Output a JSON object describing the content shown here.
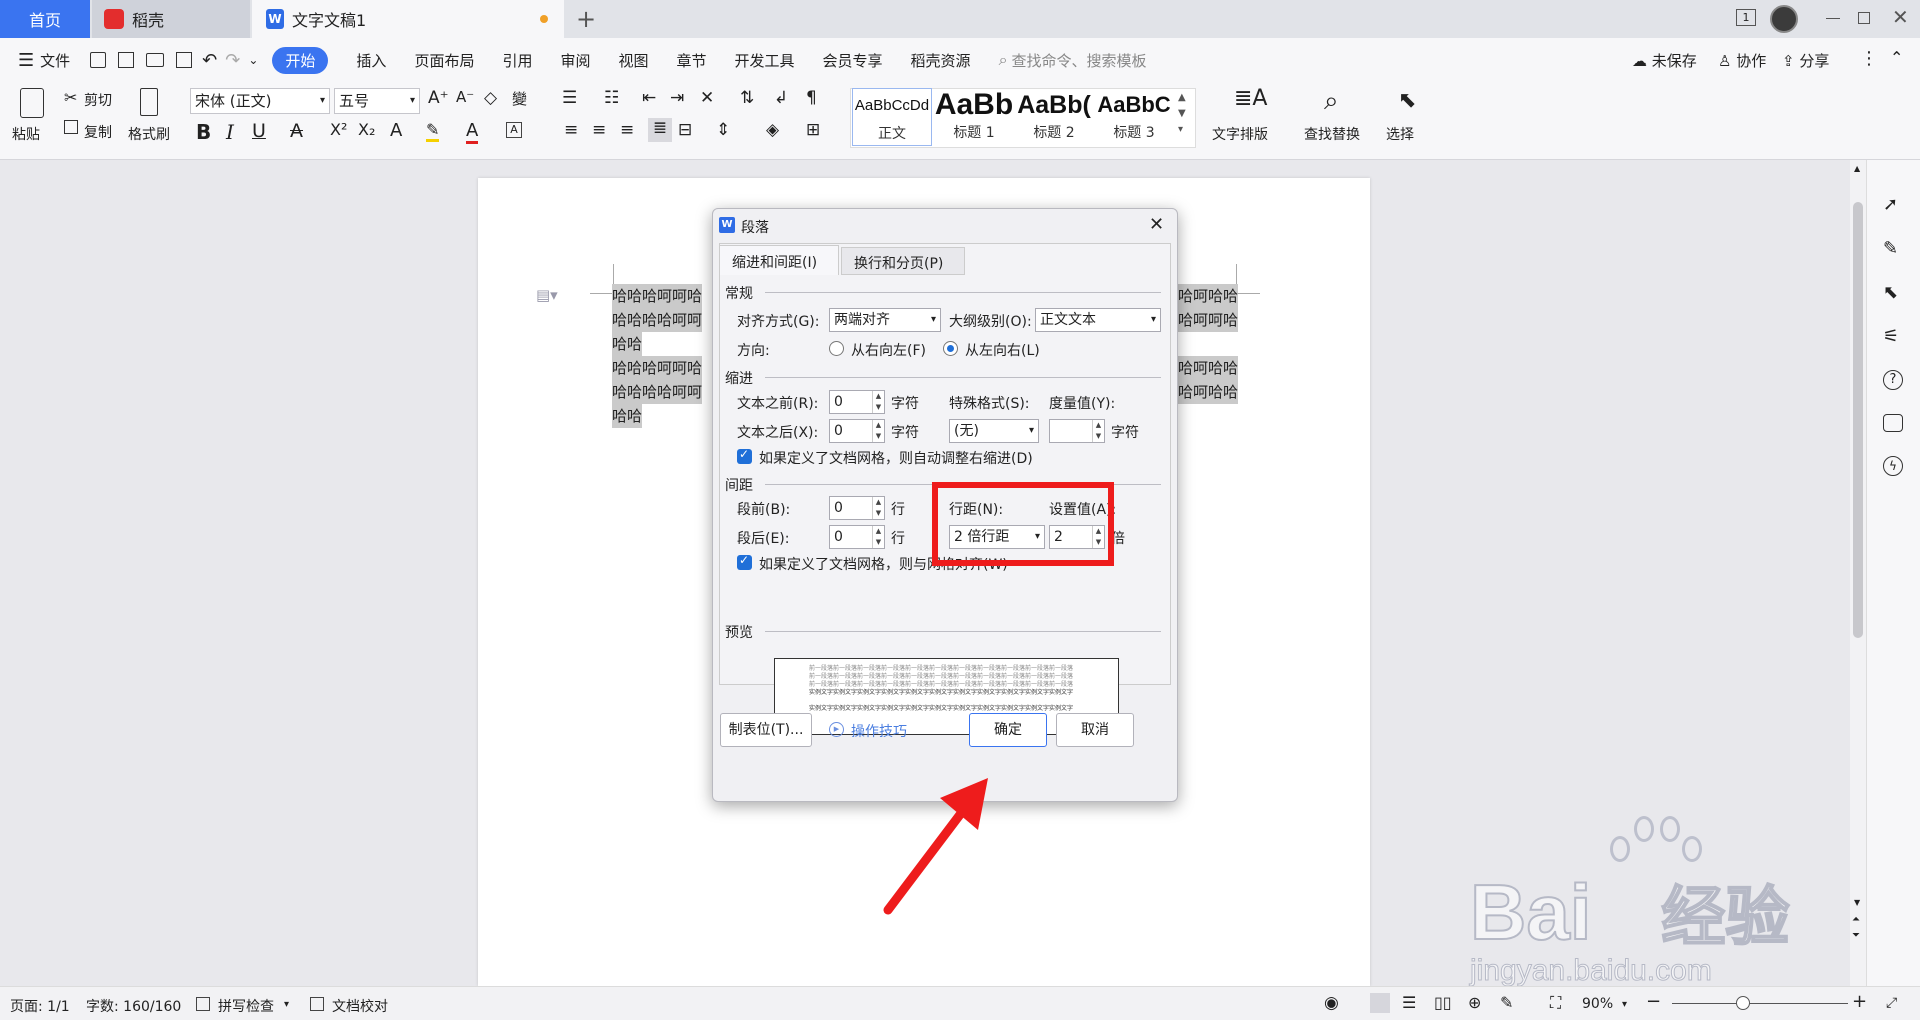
{
  "tabs": {
    "home": "首页",
    "daoke": "稻壳",
    "doc": "文字文稿1",
    "add": "+"
  },
  "window": {
    "badge": "1"
  },
  "menubar": {
    "file": "文件",
    "start": "开始",
    "items": [
      "插入",
      "页面布局",
      "引用",
      "审阅",
      "视图",
      "章节",
      "开发工具",
      "会员专享",
      "稻壳资源"
    ],
    "search_placeholder": "查找命令、搜索模板",
    "unsaved": "未保存",
    "collab": "协作",
    "share": "分享"
  },
  "ribbon": {
    "paste": "粘贴",
    "cut": "剪切",
    "copy": "复制",
    "format_painter": "格式刷",
    "font_name": "宋体 (正文)",
    "font_size": "五号",
    "styles": [
      {
        "sample": "AaBbCcDd",
        "caption": "正文"
      },
      {
        "sample": "AaBb",
        "caption": "标题 1"
      },
      {
        "sample": "AaBb(",
        "caption": "标题 2"
      },
      {
        "sample": "AaBbC",
        "caption": "标题 3"
      }
    ],
    "text_layout": "文字排版",
    "find_replace": "查找替换",
    "select": "选择"
  },
  "document": {
    "lines": [
      "哈哈哈呵呵哈",
      "哈哈哈哈呵呵",
      "哈哈",
      "哈哈哈呵呵哈",
      "哈哈哈哈呵呵",
      "哈哈"
    ],
    "right_lines": [
      "哈呵哈哈",
      "哈呵呵哈",
      "哈呵哈哈",
      "哈呵哈哈"
    ]
  },
  "dialog": {
    "title": "段落",
    "tab_indent": "缩进和间距(I)",
    "tab_break": "换行和分页(P)",
    "sec_general": "常规",
    "align_label": "对齐方式(G):",
    "align_value": "两端对齐",
    "outline_label": "大纲级别(O):",
    "outline_value": "正文文本",
    "direction_label": "方向:",
    "rtl": "从右向左(F)",
    "ltr": "从左向右(L)",
    "sec_indent": "缩进",
    "before_text_label": "文本之前(R):",
    "before_text_value": "0",
    "after_text_label": "文本之后(X):",
    "after_text_value": "0",
    "unit_char": "字符",
    "special_label": "特殊格式(S):",
    "special_value": "(无)",
    "measure_label": "度量值(Y):",
    "measure_value": "",
    "auto_indent": "如果定义了文档网格，则自动调整右缩进(D)",
    "sec_spacing": "间距",
    "before_label": "段前(B):",
    "before_value": "0",
    "after_label": "段后(E):",
    "after_value": "0",
    "unit_line": "行",
    "line_spacing_label": "行距(N):",
    "line_spacing_value": "2 倍行距",
    "set_value_label": "设置值(A):",
    "set_value": "2",
    "unit_times": "倍",
    "grid_align": "如果定义了文档网格，则与网格对齐(W)",
    "sec_preview": "预览",
    "preview_line_a": "前一段落前一段落前一段落前一段落前一段落前一段落前一段落前一段落前一段落前一段落前一段落",
    "preview_line_b": "实例文字实例文字实例文字实例文字实例文字实例文字实例文字实例文字实例文字实例文字实例文字",
    "tabs_btn": "制表位(T)...",
    "tips": "操作技巧",
    "ok": "确定",
    "cancel": "取消"
  },
  "status": {
    "page": "页面: 1/1",
    "words": "字数: 160/160",
    "spell": "拼写检查",
    "proof": "文档校对",
    "zoom": "90%"
  },
  "watermark": {
    "brand": "Bai",
    "brand2": "经验",
    "site": "jingyan.baidu.com"
  },
  "colors": {
    "accent": "#3a74f0",
    "highlight_red": "#ee1c1c",
    "checkbox": "#1f6fd8"
  }
}
